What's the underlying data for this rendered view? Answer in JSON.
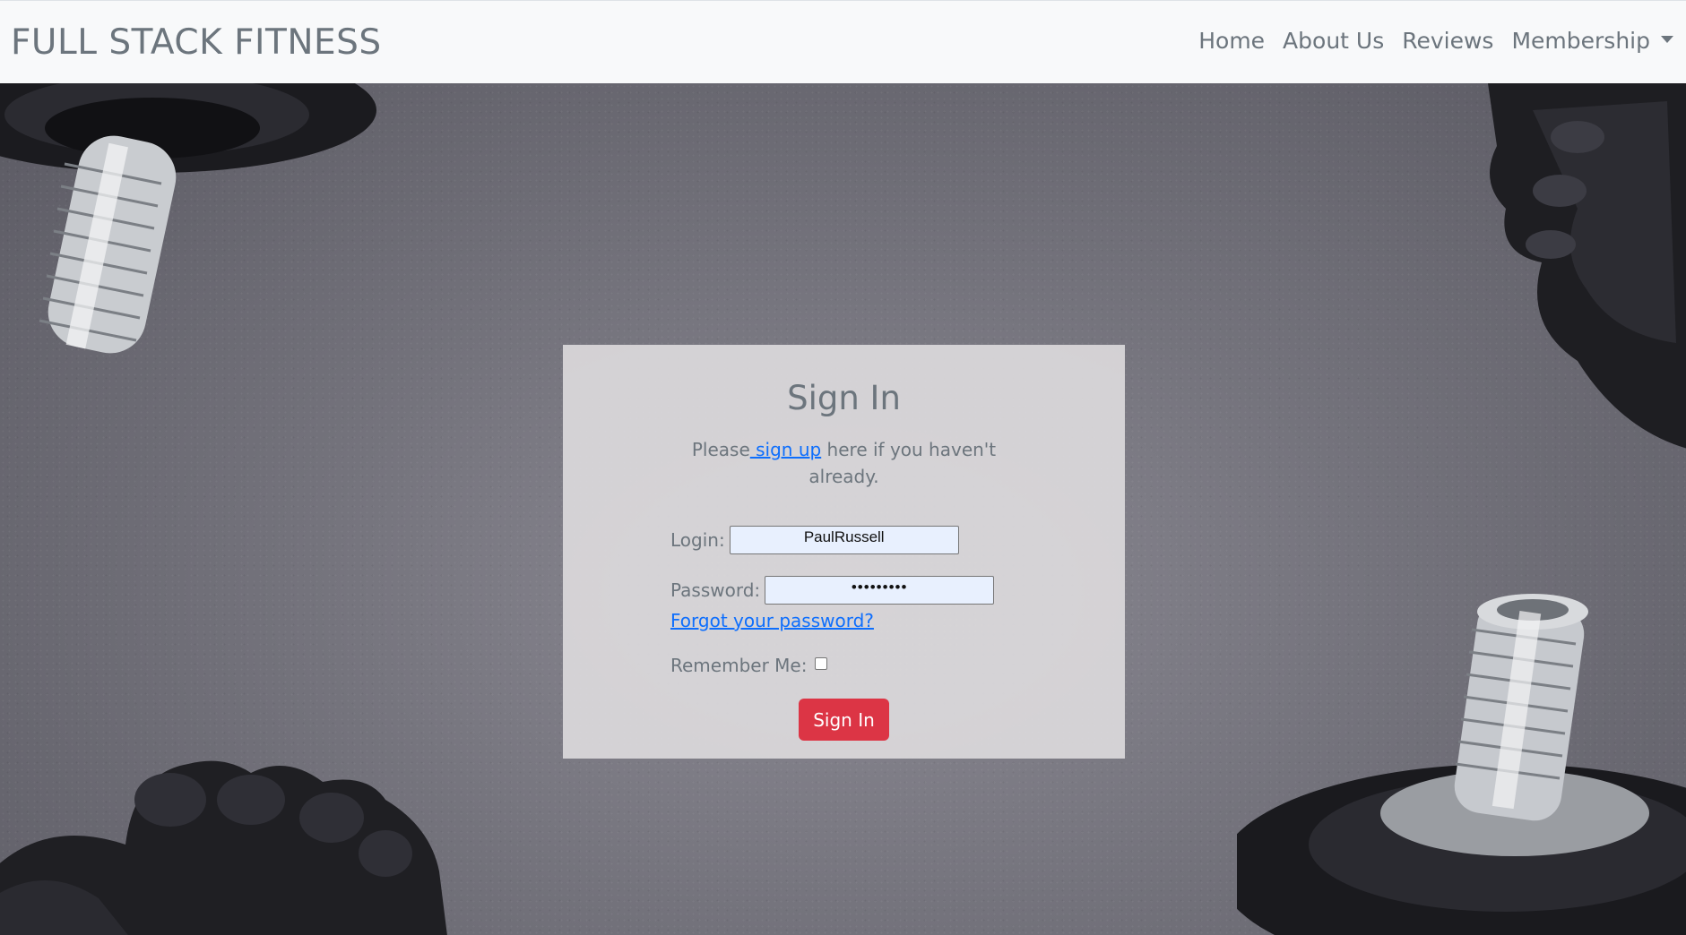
{
  "brand": "FULL STACK FITNESS",
  "nav": {
    "home": "Home",
    "about": "About Us",
    "reviews": "Reviews",
    "membership": "Membership"
  },
  "signin": {
    "title": "Sign In",
    "intro_before": "Please",
    "intro_link": " sign up",
    "intro_after": " here if you haven't already.",
    "login_label": "Login:",
    "login_value": "PaulRussell",
    "password_label": "Password:",
    "password_value": "•••••••••",
    "forgot_link": "Forgot your password?",
    "remember_label": "Remember Me:",
    "submit_label": "Sign In"
  },
  "colors": {
    "navbar_bg": "#f8f9fa",
    "muted_text": "#6c757d",
    "link": "#0d6efd",
    "primary_button": "#dc3545",
    "input_autofill": "#e8f0fe"
  },
  "icons": {
    "membership_dropdown": "caret-down-icon"
  }
}
